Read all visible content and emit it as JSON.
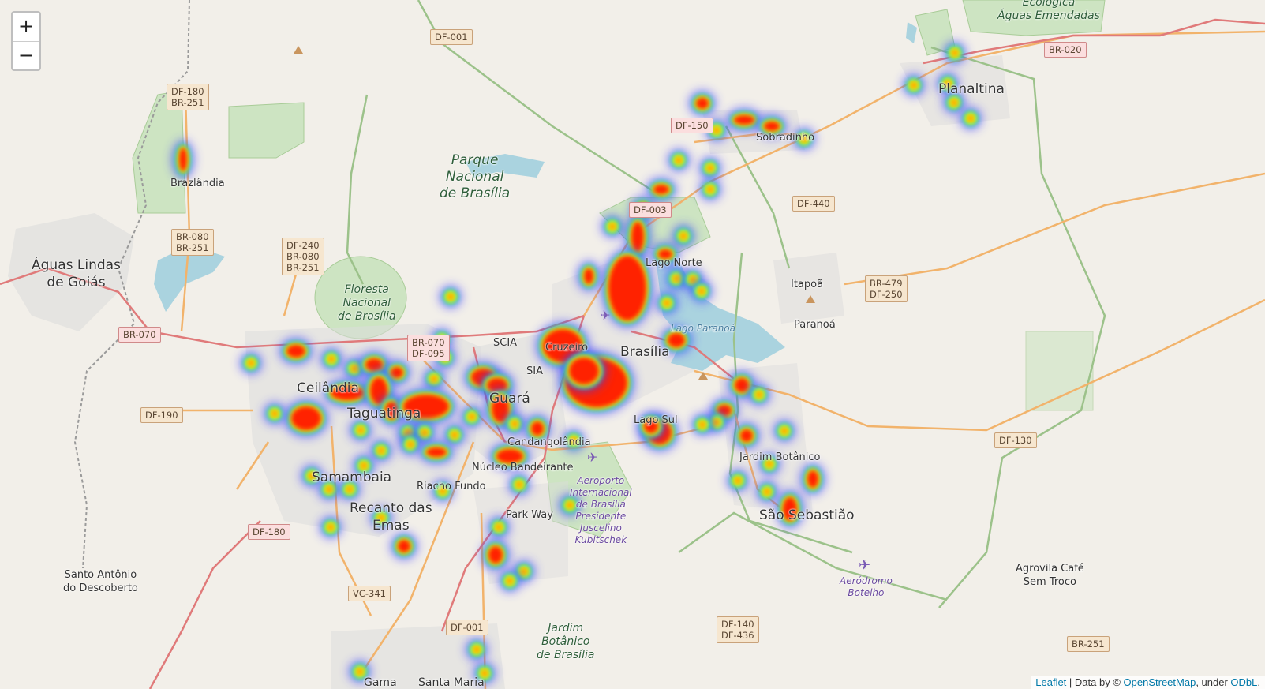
{
  "zoom": {
    "in_label": "+",
    "out_label": "−"
  },
  "attribution": {
    "leaflet": "Leaflet",
    "sep": " | Data by © ",
    "osm": "OpenStreetMap",
    "under": ", under ",
    "odbl": "ODbL",
    "end": "."
  },
  "colors": {
    "land": "#f2efe9",
    "park": "#cde4c2",
    "water": "#aad3df",
    "urban": "#dedede",
    "motorway": "#e07a7a",
    "trunk": "#f2b36b",
    "boundary": "#8fb07a"
  },
  "labels": {
    "brazlandia": "Brazlândia",
    "aguas_lindas": "Águas Lindas\nde Goiás",
    "ceilandia": "Ceilândia",
    "taguatinga": "Taguatinga",
    "samambaia": "Samambaia",
    "recanto": "Recanto das\nEmas",
    "riacho": "Riacho Fundo",
    "nucleo": "Núcleo Bandeirante",
    "candangolandia": "Candangolândia",
    "guara": "Guará",
    "scia": "SCIA",
    "sia": "SIA",
    "cruzeiro": "Cruzeiro",
    "brasilia": "Brasília",
    "lago_norte": "Lago Norte",
    "lago_sul": "Lago Sul",
    "itapoa": "Itapoã",
    "paranoa": "Paranoá",
    "sobradinho": "Sobradinho",
    "planaltina": "Planaltina",
    "jardim_botanico": "Jardim Botânico",
    "sao_sebastiao": "São Sebastião",
    "park_way": "Park Way",
    "santo_antonio": "Santo Antônio\ndo Descoberto",
    "agrovila": "Agrovila Café\nSem Troco",
    "gama": "Gama",
    "santa_maria": "Santa Maria"
  },
  "parks": {
    "parque_nacional": "Parque\nNacional\nde Brasília",
    "floresta": "Floresta\nNacional\nde Brasília",
    "ecologica": "Ecológica\nÁguas Emendadas",
    "jardim_botanico": "Jardim\nBotânico\nde Brasília"
  },
  "water": {
    "lago_paranoa": "Lago Paranoá"
  },
  "airports": {
    "brasilia": "Aeroporto\nInternacional\nde Brasília\nPresidente\nJuscelino\nKubitschek",
    "botelho": "Aeródromo\nBotelho"
  },
  "shields": {
    "df001_top": "DF-001",
    "df180_br251": "DF-180\nBR-251",
    "df150": "DF-150",
    "br020": "BR-020",
    "df440": "DF-440",
    "df003": "DF-003",
    "br080_br251": "BR-080\nBR-251",
    "df240": "DF-240\nBR-080\nBR-251",
    "br479": "BR-479\nDF-250",
    "br070": "BR-070",
    "br070_df095": "BR-070\nDF-095",
    "df190": "DF-190",
    "df130": "DF-130",
    "df180": "DF-180",
    "vc341": "VC-341",
    "df001_bottom": "DF-001",
    "df140": "DF-140\nDF-436",
    "br251": "BR-251"
  }
}
